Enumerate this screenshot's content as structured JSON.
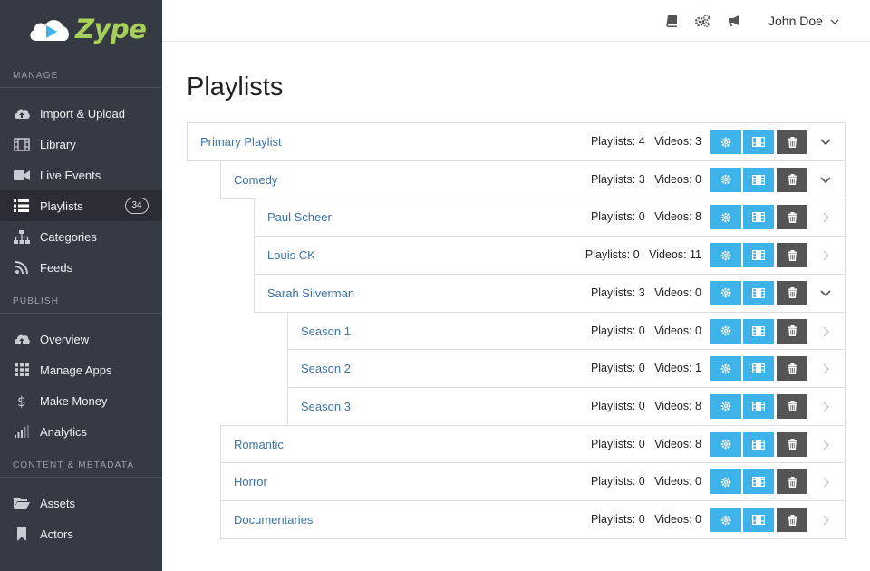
{
  "brand": {
    "name": "Zype",
    "logo_color": "#a6d05a"
  },
  "sidebar": {
    "sections": [
      {
        "label": "MANAGE",
        "items": [
          {
            "label": "Import & Upload",
            "icon": "cloud-upload-icon"
          },
          {
            "label": "Library",
            "icon": "film-grid-icon"
          },
          {
            "label": "Live Events",
            "icon": "video-camera-icon"
          },
          {
            "label": "Playlists",
            "icon": "list-icon",
            "badge": "34",
            "active": true
          },
          {
            "label": "Categories",
            "icon": "sitemap-icon"
          },
          {
            "label": "Feeds",
            "icon": "rss-icon"
          }
        ]
      },
      {
        "label": "PUBLISH",
        "items": [
          {
            "label": "Overview",
            "icon": "cloud-upload-icon"
          },
          {
            "label": "Manage Apps",
            "icon": "grid-icon"
          },
          {
            "label": "Make Money",
            "icon": "dollar-icon"
          },
          {
            "label": "Analytics",
            "icon": "signal-bars-icon"
          }
        ]
      },
      {
        "label": "CONTENT & METADATA",
        "items": [
          {
            "label": "Assets",
            "icon": "folder-open-icon"
          },
          {
            "label": "Actors",
            "icon": "bookmark-icon"
          }
        ]
      }
    ]
  },
  "topbar": {
    "icons": [
      "book-icon",
      "gears-icon",
      "bullhorn-icon"
    ],
    "user_name": "John Doe"
  },
  "page_title": "Playlists",
  "rows": [
    {
      "name": "Primary Playlist",
      "counts": "Playlists: 4   Videos: 3",
      "depth": 0,
      "expanded": true,
      "has_children": true
    },
    {
      "name": "Comedy",
      "counts": "Playlists: 3   Videos: 0",
      "depth": 1,
      "expanded": true,
      "has_children": true
    },
    {
      "name": "Paul Scheer",
      "counts": "Playlists: 0   Videos: 8",
      "depth": 2,
      "expanded": false,
      "has_children": false
    },
    {
      "name": "Louis CK",
      "counts": "Playlists: 0   Videos: 11",
      "depth": 2,
      "expanded": false,
      "has_children": false
    },
    {
      "name": "Sarah Silverman",
      "counts": "Playlists: 3   Videos: 0",
      "depth": 2,
      "expanded": true,
      "has_children": true
    },
    {
      "name": "Season 1",
      "counts": "Playlists: 0   Videos: 0",
      "depth": 3,
      "expanded": false,
      "has_children": false
    },
    {
      "name": "Season 2",
      "counts": "Playlists: 0   Videos: 1",
      "depth": 3,
      "expanded": false,
      "has_children": false
    },
    {
      "name": "Season 3",
      "counts": "Playlists: 0   Videos: 8",
      "depth": 3,
      "expanded": false,
      "has_children": false
    },
    {
      "name": "Romantic",
      "counts": "Playlists: 0   Videos: 8",
      "depth": 1,
      "expanded": false,
      "has_children": false
    },
    {
      "name": "Horror",
      "counts": "Playlists: 0   Videos: 0",
      "depth": 1,
      "expanded": false,
      "has_children": false
    },
    {
      "name": "Documentaries",
      "counts": "Playlists: 0   Videos: 0",
      "depth": 1,
      "expanded": false,
      "has_children": false
    }
  ],
  "row_actions": [
    {
      "name": "settings",
      "icon": "gear-icon",
      "color": "#3eb3e9"
    },
    {
      "name": "videos",
      "icon": "film-icon",
      "color": "#3eb3e9"
    },
    {
      "name": "delete",
      "icon": "trash-icon",
      "color": "#555555"
    }
  ],
  "colors": {
    "sidebar_bg": "#363a43",
    "active_bg": "#2a2d34",
    "link": "#3d72a6",
    "accent": "#3eb3e9"
  }
}
